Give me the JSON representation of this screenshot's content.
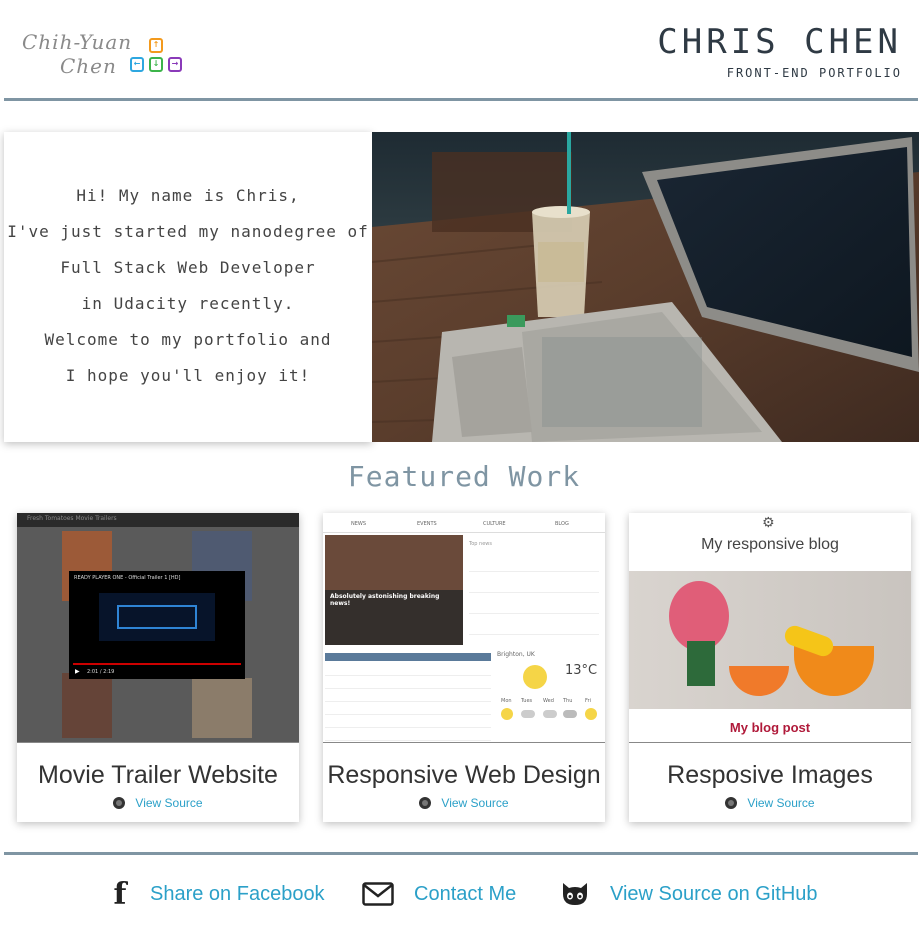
{
  "header": {
    "logo": {
      "line1": "Chih-Yuan",
      "line2": "Chen",
      "keys": [
        "↑",
        "←",
        "↓",
        "→"
      ]
    },
    "title": "CHRIS CHEN",
    "subtitle": "FRONT-END PORTFOLIO"
  },
  "hero": {
    "intro_lines": [
      "Hi! My name is Chris,",
      "I've just started my nanodegree of",
      "Full Stack Web Developer",
      "in Udacity recently.",
      "Welcome to my portfolio and",
      "I hope you'll enjoy it!"
    ]
  },
  "featured": {
    "heading": "Featured Work",
    "cards": [
      {
        "title": "Movie Trailer Website",
        "source_label": "View Source",
        "thumb": {
          "video_title": "READY PLAYER ONE - Official Trailer 1 [HD]",
          "time": "2:01 / 2:19",
          "bg_word": "Fresh Tomatoes Movie Trailers"
        }
      },
      {
        "title": "Responsive Web Design",
        "source_label": "View Source",
        "thumb": {
          "nav": [
            "NEWS",
            "EVENTS",
            "CULTURE",
            "BLOG"
          ],
          "headline": "Absolutely astonishing breaking news!",
          "topnews": "Top news",
          "location": "Brighton, UK",
          "temp": "13°C",
          "days": [
            "Mon",
            "Tues",
            "Wed",
            "Thu",
            "Fri"
          ]
        }
      },
      {
        "title": "Resposive Images",
        "source_label": "View Source",
        "thumb": {
          "blog_title": "My responsive blog",
          "post_title": "My blog post"
        }
      }
    ]
  },
  "footer": {
    "facebook": "Share on Facebook",
    "contact": "Contact Me",
    "github": "View Source on GitHub"
  },
  "colors": {
    "accent": "#2ba0c8",
    "rule": "#7f95a3",
    "title": "#2f3a44"
  }
}
